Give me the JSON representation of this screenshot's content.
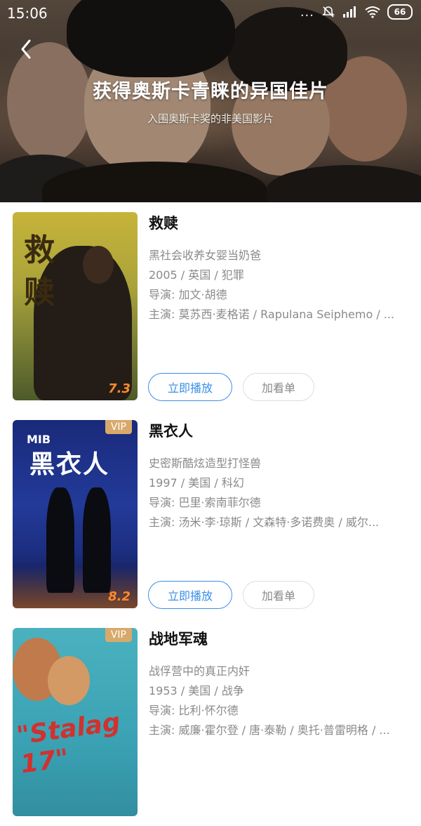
{
  "status_bar": {
    "time": "15:06",
    "dots": "...",
    "battery": "66"
  },
  "header": {
    "title": "获得奥斯卡青睐的异国佳片",
    "subtitle": "入围奥斯卡奖的非美国影片",
    "back_icon": "chevron-left-icon"
  },
  "buttons": {
    "play": "立即播放",
    "watchlist": "加看单"
  },
  "movies": [
    {
      "title": "救赎",
      "tagline": "黑社会收养女婴当奶爸",
      "meta": "2005 / 英国 / 犯罪",
      "director": "导演: 加文·胡德",
      "cast": "主演: 莫苏西·麦格诺 / Rapulana Seiphemo / ...",
      "rating": "7.3",
      "poster_text": [
        "救",
        "赎"
      ]
    },
    {
      "title": "黑衣人",
      "tagline": "史密斯酷炫造型打怪兽",
      "meta": "1997 / 美国 / 科幻",
      "director": "导演: 巴里·索南菲尔德",
      "cast": "主演: 汤米·李·琼斯 / 文森特·多诺费奥 / 威尔...",
      "rating": "8.2",
      "vip": "VIP",
      "poster_logo": "MIB",
      "poster_text": "黑衣人"
    },
    {
      "title": "战地军魂",
      "tagline": "战俘营中的真正内奸",
      "meta": "1953 / 美国 / 战争",
      "director": "导演: 比利·怀尔德",
      "cast": "主演: 威廉·霍尔登 / 唐·泰勒 / 奥托·普雷明格 / ...",
      "vip": "VIP",
      "poster_text": "\"Stalag 17\""
    }
  ],
  "colors": {
    "accent": "#3b8ee8",
    "rating": "#ff8a2a",
    "vip": "#d8a96a"
  }
}
